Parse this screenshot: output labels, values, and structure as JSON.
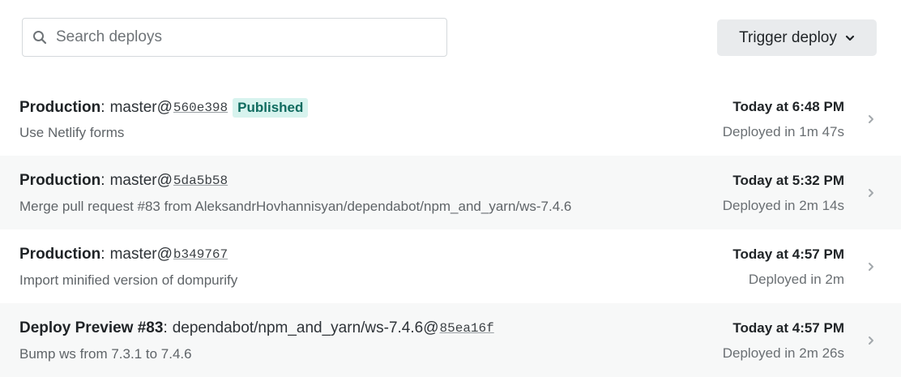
{
  "search": {
    "placeholder": "Search deploys",
    "value": ""
  },
  "toolbar": {
    "trigger_label": "Trigger deploy"
  },
  "deploys": [
    {
      "context": "Production",
      "separator": ":",
      "branch": "master@",
      "sha": "560e398",
      "badge": "Published",
      "message": "Use Netlify forms",
      "time": "Today at 6:48 PM",
      "duration": "Deployed in 1m 47s"
    },
    {
      "context": "Production",
      "separator": ":",
      "branch": "master@",
      "sha": "5da5b58",
      "badge": "",
      "message": "Merge pull request #83 from AleksandrHovhannisyan/dependabot/npm_and_yarn/ws-7.4.6",
      "time": "Today at 5:32 PM",
      "duration": "Deployed in 2m 14s"
    },
    {
      "context": "Production",
      "separator": ":",
      "branch": "master@",
      "sha": "b349767",
      "badge": "",
      "message": "Import minified version of dompurify",
      "time": "Today at 4:57 PM",
      "duration": "Deployed in 2m"
    },
    {
      "context": "Deploy Preview #83",
      "separator": ":",
      "branch": "dependabot/npm_and_yarn/ws-7.4.6@",
      "sha": "85ea16f",
      "badge": "",
      "message": "Bump ws from 7.3.1 to 7.4.6",
      "time": "Today at 4:57 PM",
      "duration": "Deployed in 2m 26s"
    }
  ],
  "colors": {
    "badge_bg": "#d7f3ee",
    "badge_text": "#0f6b5f",
    "alt_row_bg": "#f7f8f8",
    "button_bg": "#e9ebed"
  },
  "icons": {
    "search": "search-icon",
    "trigger_chevron": "chevron-down-icon",
    "row_arrow": "chevron-right-icon"
  }
}
